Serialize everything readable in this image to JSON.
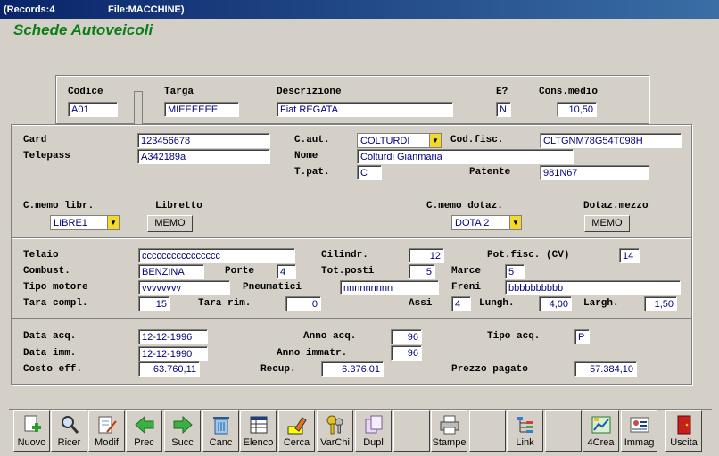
{
  "titlebar": {
    "records": "(Records:4",
    "file": "File:MACCHINE)"
  },
  "app_title": "Schede Autoveicoli",
  "top": {
    "codice_label": "Codice",
    "codice": "A01",
    "targa_label": "Targa",
    "targa": "MIEEEEEE",
    "descr_label": "Descrizione",
    "descr": "Fiat REGATA",
    "e_label": "E?",
    "e": "N",
    "cons_label": "Cons.medio",
    "cons": "10,50"
  },
  "sec1": {
    "card_label": "Card",
    "card": "123456678",
    "telepass_label": "Telepass",
    "telepass": "A342189a",
    "caut_label": "C.aut.",
    "caut": "COLTURDI",
    "codfisc_label": "Cod.fisc.",
    "codfisc": "CLTGNM78G54T098H",
    "nome_label": "Nome",
    "nome": "Colturdi Gianmaria",
    "tpat_label": "T.pat.",
    "tpat": "C",
    "patente_label": "Patente",
    "patente": "981N67",
    "cmemo_libr_label": "C.memo libr.",
    "cmemo_libr": "LIBRE1",
    "libretto_label": "Libretto",
    "memo1": "MEMO",
    "cmemo_dotaz_label": "C.memo dotaz.",
    "cmemo_dotaz": "DOTA 2",
    "dotaz_mezzo_label": "Dotaz.mezzo",
    "memo2": "MEMO"
  },
  "sec2": {
    "telaio_label": "Telaio",
    "telaio": "cccccccccccccccc",
    "cilindr_label": "Cilindr.",
    "cilindr": "12",
    "potfisc_label": "Pot.fisc. (CV)",
    "potfisc": "14",
    "combust_label": "Combust.",
    "combust": "BENZINA",
    "porte_label": "Porte",
    "porte": "4",
    "totposti_label": "Tot.posti",
    "totposti": "5",
    "marce_label": "Marce",
    "marce": "5",
    "tipomotore_label": "Tipo motore",
    "tipomotore": "vvvvvvvv",
    "pneumatici_label": "Pneumatici",
    "pneumatici": "nnnnnnnnn",
    "freni_label": "Freni",
    "freni": "bbbbbbbbbb",
    "taracompl_label": "Tara compl.",
    "taracompl": "15",
    "tararim_label": "Tara rim.",
    "tararim": "0",
    "assi_label": "Assi",
    "assi": "4",
    "lungh_label": "Lungh.",
    "lungh": "4,00",
    "largh_label": "Largh.",
    "largh": "1,50"
  },
  "sec3": {
    "dataacq_label": "Data acq.",
    "dataacq": "12-12-1996",
    "annoacq_label": "Anno acq.",
    "annoacq": "96",
    "tipoacq_label": "Tipo acq.",
    "tipoacq": "P",
    "dataimm_label": "Data imm.",
    "dataimm": "12-12-1990",
    "annoimmatr_label": "Anno immatr.",
    "annoimmatr": "96",
    "costoeff_label": "Costo eff.",
    "costoeff": "63.760,11",
    "recup_label": "Recup.",
    "recup": "6.376,01",
    "prezzo_label": "Prezzo pagato",
    "prezzo": "57.384,10"
  },
  "toolbar": {
    "nuovo": "Nuovo",
    "ricer": "Ricer",
    "modif": "Modif",
    "prec": "Prec",
    "succ": "Succ",
    "canc": "Canc",
    "elenco": "Elenco",
    "cerca": "Cerca",
    "varchi": "VarChi",
    "dupl": "Dupl",
    "stampe": "Stampe",
    "link": "Link",
    "crea": "4Crea",
    "immag": "Immag",
    "uscita": "Uscita"
  },
  "colors": {
    "title_green": "#0a7d18",
    "field_text": "#000080",
    "combo_arrow": "#f3d92a"
  }
}
